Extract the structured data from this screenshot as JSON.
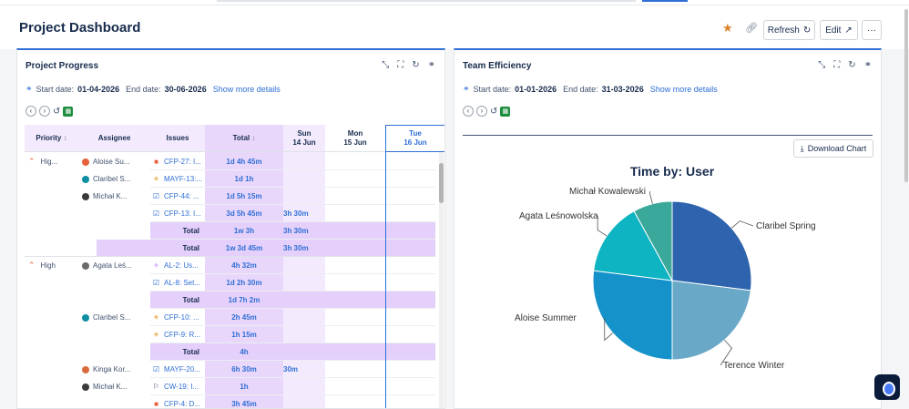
{
  "header": {
    "title": "Project Dashboard",
    "refresh_label": "Refresh",
    "edit_label": "Edit",
    "more_label": "···"
  },
  "progress": {
    "title": "Project Progress",
    "start_label": "Start date:",
    "start_value": "01-04-2026",
    "end_label": "End date:",
    "end_value": "30-06-2026",
    "more_link": "Show more details",
    "columns": {
      "priority": "Priority",
      "assignee": "Assignee",
      "issues": "Issues",
      "total": "Total",
      "day1": "Sun",
      "day1_date": "14 Jun",
      "day2": "Mon",
      "day2_date": "15 Jun",
      "day3": "Tue",
      "day3_date": "16 Jun"
    },
    "rows": [
      {
        "priority": "Hig...",
        "assignee": "Aloise Su...",
        "issue": "CFP-27: I...",
        "total": "1d 4h 45m",
        "sun": ""
      },
      {
        "priority": "",
        "assignee": "Claribel S...",
        "issue": "MAYF-13:...",
        "total": "1d 1h",
        "sun": ""
      },
      {
        "priority": "",
        "assignee": "Michał K...",
        "issue": "CFP-44: ...",
        "total": "1d 5h 15m",
        "sun": ""
      },
      {
        "priority": "",
        "assignee": "",
        "issue": "CFP-13: I...",
        "total": "3d 5h 45m",
        "sun": "3h 30m"
      },
      {
        "priority": "",
        "assignee": "",
        "issue": "Total",
        "total": "1w 3h",
        "sun": "3h 30m"
      },
      {
        "priority": "",
        "assignee": "",
        "issue": "Total",
        "total": "1w 3d 45m",
        "sun": "3h 30m"
      },
      {
        "priority": "High",
        "assignee": "Agata Leś...",
        "issue": "AL-2: Us...",
        "total": "4h 32m",
        "sun": ""
      },
      {
        "priority": "",
        "assignee": "",
        "issue": "AL-8: Set...",
        "total": "1d 2h 30m",
        "sun": ""
      },
      {
        "priority": "",
        "assignee": "",
        "issue": "Total",
        "total": "1d 7h 2m",
        "sun": ""
      },
      {
        "priority": "",
        "assignee": "Claribel S...",
        "issue": "CFP-10: ...",
        "total": "2h 45m",
        "sun": ""
      },
      {
        "priority": "",
        "assignee": "",
        "issue": "CFP-9: R...",
        "total": "1h 15m",
        "sun": ""
      },
      {
        "priority": "",
        "assignee": "",
        "issue": "Total",
        "total": "4h",
        "sun": ""
      },
      {
        "priority": "",
        "assignee": "Kinga Kor...",
        "issue": "MAYF-20...",
        "total": "6h 30m",
        "sun": "30m"
      },
      {
        "priority": "",
        "assignee": "Michał K...",
        "issue": "CW-19: I...",
        "total": "1h",
        "sun": ""
      },
      {
        "priority": "",
        "assignee": "",
        "issue": "CFP-4: D...",
        "total": "3h 45m",
        "sun": ""
      }
    ]
  },
  "efficiency": {
    "title": "Team Efficiency",
    "start_label": "Start date:",
    "start_value": "01-01-2026",
    "end_label": "End date:",
    "end_value": "31-03-2026",
    "more_link": "Show more details",
    "download_label": "Download Chart"
  },
  "chart_data": {
    "type": "pie",
    "title": "Time by: User",
    "categories": [
      "Claribel Spring",
      "Terence Winter",
      "Aloise Summer",
      "Agata Leśnowolska",
      "Michał Kowalewski"
    ],
    "values": [
      27,
      23,
      27,
      15,
      8
    ],
    "colors": [
      "#2e63ad",
      "#6aa8c7",
      "#1592c9",
      "#0eb4c2",
      "#3aa89a"
    ]
  }
}
